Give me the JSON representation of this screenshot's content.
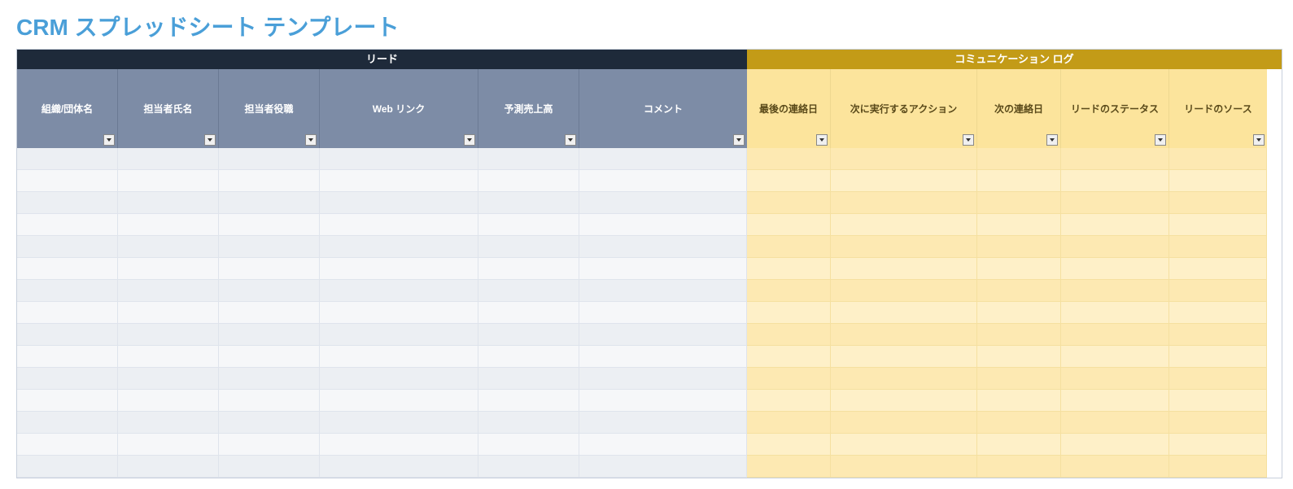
{
  "title": "CRM スプレッドシート テンプレート",
  "groups": {
    "lead": {
      "title": "リード",
      "columns": [
        "組織/団体名",
        "担当者氏名",
        "担当者役職",
        "Web リンク",
        "予測売上高",
        "コメント"
      ]
    },
    "comm": {
      "title": "コミュニケーション ログ",
      "columns": [
        "最後の連絡日",
        "次に実行するアクション",
        "次の連絡日",
        "リードのステータス",
        "リードのソース"
      ]
    }
  },
  "row_count": 15
}
